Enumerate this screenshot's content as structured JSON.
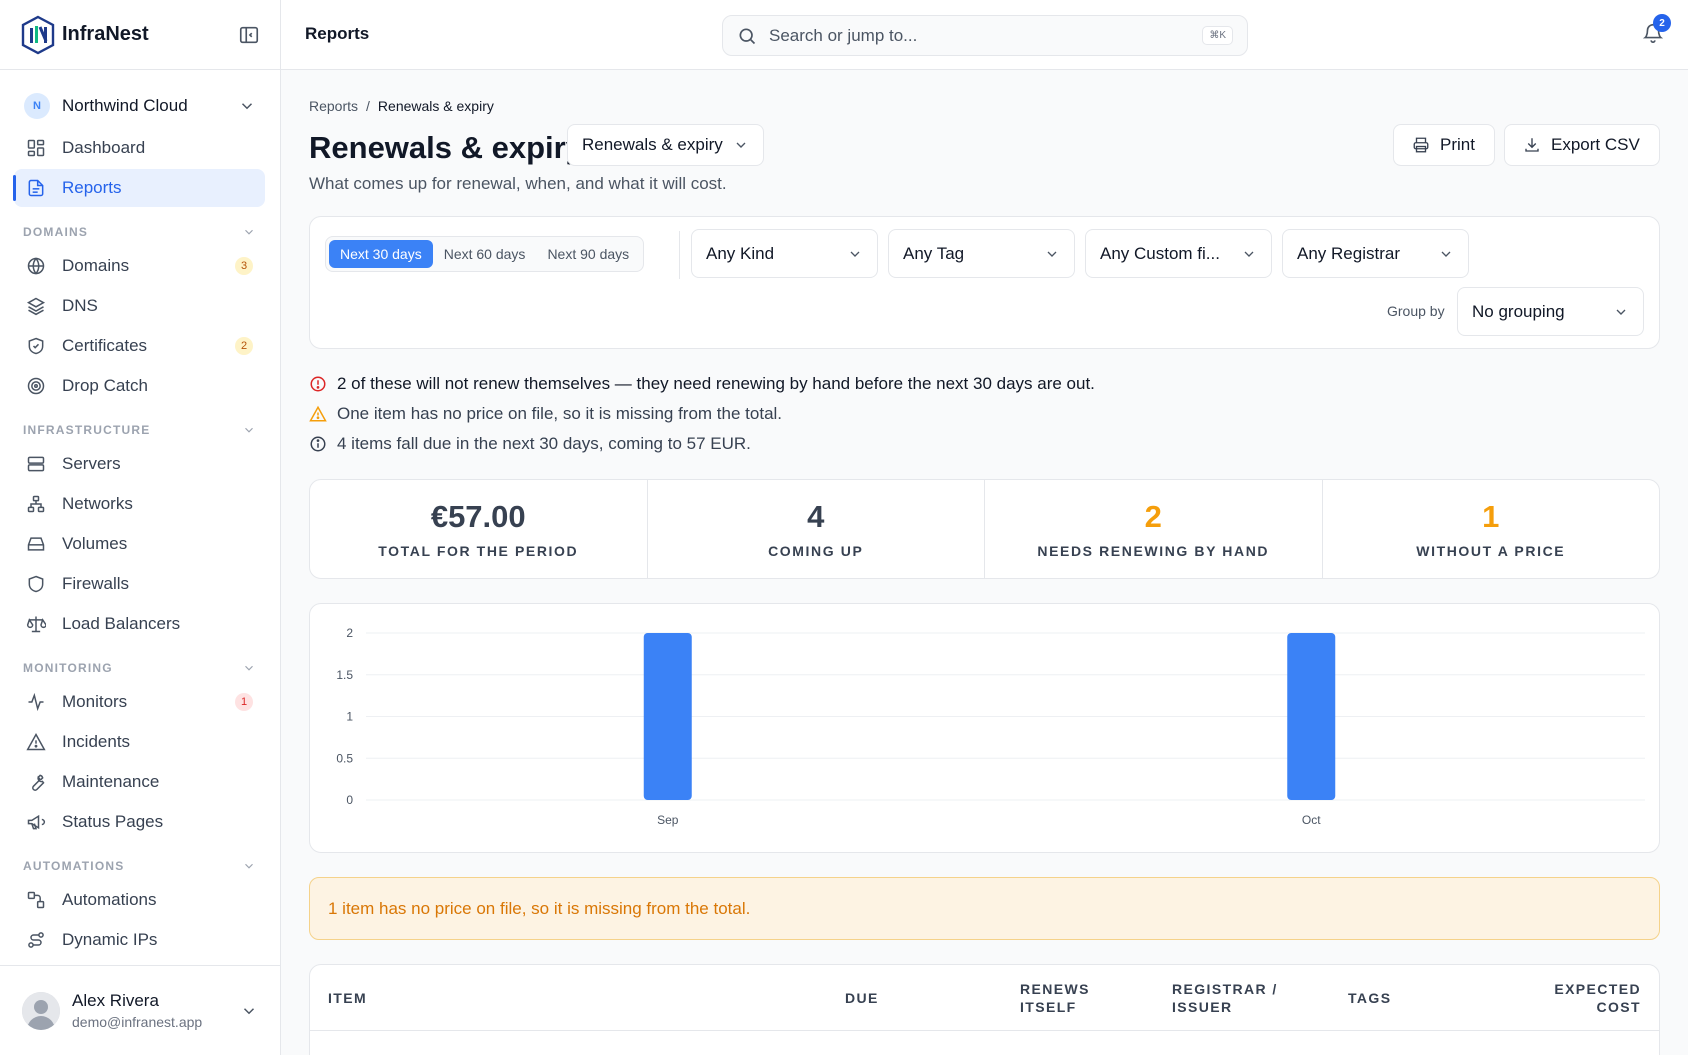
{
  "brand": {
    "name": "InfraNest"
  },
  "org": {
    "initial": "N",
    "name": "Northwind Cloud"
  },
  "nav": {
    "top": [
      {
        "label": "Dashboard",
        "icon": "dashboard-icon"
      },
      {
        "label": "Reports",
        "icon": "report-icon",
        "active": true
      }
    ],
    "sections": [
      {
        "title": "DOMAINS",
        "items": [
          {
            "label": "Domains",
            "icon": "globe-icon",
            "badge": "3",
            "badge_color": "amber"
          },
          {
            "label": "DNS",
            "icon": "layers-icon"
          },
          {
            "label": "Certificates",
            "icon": "shield-check-icon",
            "badge": "2",
            "badge_color": "amber"
          },
          {
            "label": "Drop Catch",
            "icon": "target-icon"
          }
        ]
      },
      {
        "title": "INFRASTRUCTURE",
        "items": [
          {
            "label": "Servers",
            "icon": "server-icon"
          },
          {
            "label": "Networks",
            "icon": "network-icon"
          },
          {
            "label": "Volumes",
            "icon": "drive-icon"
          },
          {
            "label": "Firewalls",
            "icon": "shield-icon"
          },
          {
            "label": "Load Balancers",
            "icon": "scale-icon"
          }
        ]
      },
      {
        "title": "MONITORING",
        "items": [
          {
            "label": "Monitors",
            "icon": "activity-icon",
            "badge": "1",
            "badge_color": "red"
          },
          {
            "label": "Incidents",
            "icon": "alert-triangle-icon"
          },
          {
            "label": "Maintenance",
            "icon": "wrench-icon"
          },
          {
            "label": "Status Pages",
            "icon": "megaphone-icon"
          }
        ]
      },
      {
        "title": "AUTOMATIONS",
        "items": [
          {
            "label": "Automations",
            "icon": "workflow-icon"
          },
          {
            "label": "Dynamic IPs",
            "icon": "route-icon"
          }
        ]
      }
    ]
  },
  "user": {
    "name": "Alex Rivera",
    "email": "demo@infranest.app"
  },
  "topbar": {
    "title": "Reports",
    "search_placeholder": "Search or jump to...",
    "shortcut": "⌘K",
    "notifications": "2"
  },
  "breadcrumb": {
    "root": "Reports",
    "sep": "/",
    "current": "Renewals & expiry"
  },
  "page": {
    "title": "Renewals & expiry",
    "view": "Renewals & expiry",
    "subtitle": "What comes up for renewal, when, and what it will cost.",
    "print_label": "Print",
    "export_label": "Export CSV"
  },
  "filters": {
    "periods": [
      "Next 30 days",
      "Next 60 days",
      "Next 90 days"
    ],
    "active_period": 0,
    "kind": "Any Kind",
    "tag": "Any Tag",
    "custom": "Any Custom fi...",
    "registrar": "Any Registrar",
    "group_label": "Group by",
    "group": "No grouping"
  },
  "alerts": {
    "error": "2 of these will not renew themselves — they need renewing by hand before the next 30 days are out.",
    "warning": "One item has no price on file, so it is missing from the total.",
    "info": "4 items fall due in the next 30 days, coming to 57 EUR."
  },
  "stats": [
    {
      "value": "€57.00",
      "label": "TOTAL FOR THE PERIOD",
      "accent": false
    },
    {
      "value": "4",
      "label": "COMING UP",
      "accent": false
    },
    {
      "value": "2",
      "label": "NEEDS RENEWING BY HAND",
      "accent": true
    },
    {
      "value": "1",
      "label": "WITHOUT A PRICE",
      "accent": true
    }
  ],
  "chart_data": {
    "type": "bar",
    "categories": [
      "Sep",
      "Oct"
    ],
    "values": [
      2,
      2
    ],
    "yticks": [
      "0",
      "0.5",
      "1",
      "1.5",
      "2"
    ],
    "ylim": [
      0,
      2
    ],
    "grid": true,
    "color": "#3b82f6"
  },
  "banner": "1 item has no price on file, so it is missing from the total.",
  "table": {
    "headers": [
      "ITEM",
      "DUE",
      "RENEWS ITSELF",
      "REGISTRAR / ISSUER",
      "TAGS",
      "EXPECTED COST"
    ]
  },
  "colors": {
    "accent": "#3b82f6",
    "amber": "#f59e0b",
    "danger": "#dc2626"
  }
}
